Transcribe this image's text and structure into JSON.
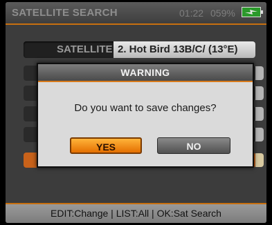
{
  "header": {
    "title": "SATELLITE SEARCH",
    "time": "01:22",
    "battery_percent": "059%",
    "battery_icon": "battery-charging-icon",
    "accent_color": "#c8700f"
  },
  "satellite_field": {
    "label": "SATELLITE",
    "value": "2. Hot Bird 13B/C/ (13°E)"
  },
  "dialog": {
    "title": "WARNING",
    "message": "Do you want to save changes?",
    "yes_label": "YES",
    "no_label": "NO",
    "selected": "YES"
  },
  "footer": {
    "hint": "EDIT:Change | LIST:All | OK:Sat Search"
  }
}
